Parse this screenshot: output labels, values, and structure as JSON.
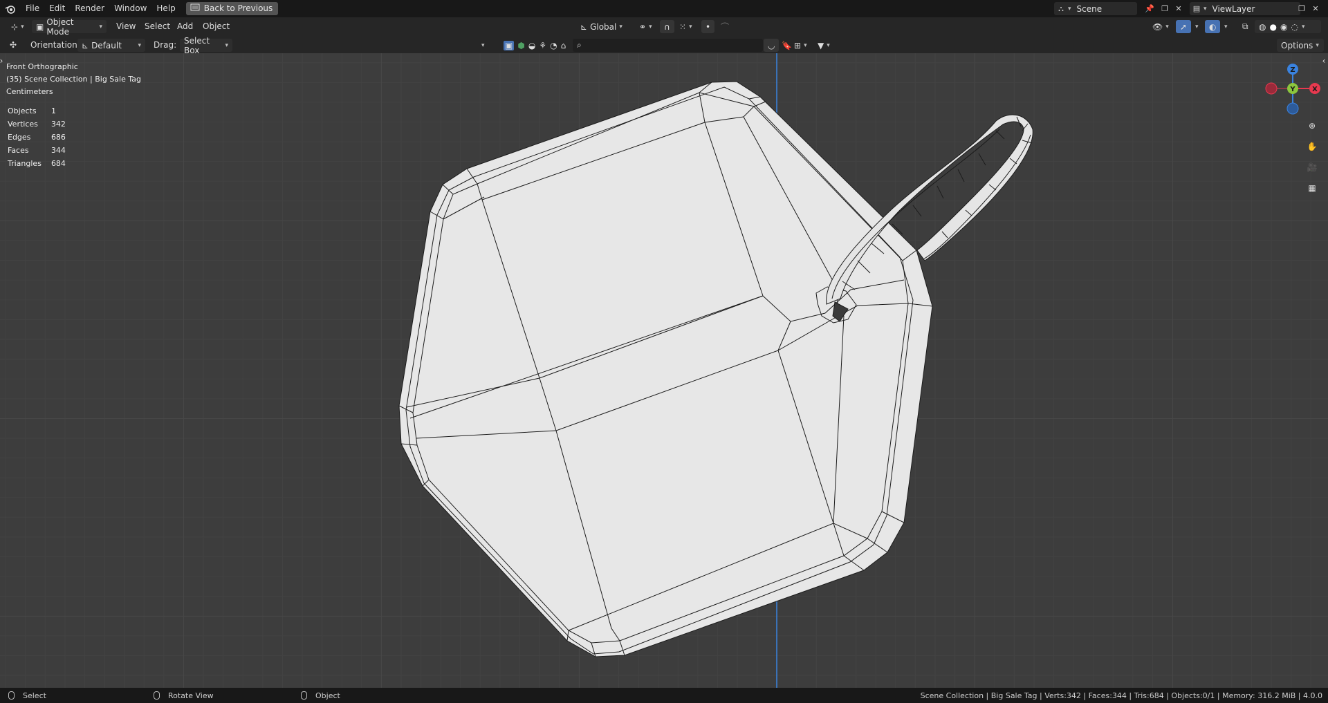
{
  "menu": {
    "file": "File",
    "edit": "Edit",
    "render": "Render",
    "window": "Window",
    "help": "Help",
    "back": "Back to Previous"
  },
  "scene": {
    "name": "Scene",
    "view_layer": "ViewLayer"
  },
  "header": {
    "mode": "Object Mode",
    "view": "View",
    "select": "Select",
    "add": "Add",
    "object": "Object",
    "transform_orientation": "Global"
  },
  "tool_settings": {
    "orientation_label": "Orientation:",
    "orientation_value": "Default",
    "drag_label": "Drag:",
    "drag_value": "Select Box",
    "options": "Options"
  },
  "viewport": {
    "view_name": "Front Orthographic",
    "collection": "(35) Scene Collection | Big Sale Tag",
    "units": "Centimeters",
    "stats": [
      {
        "label": "Objects",
        "value": "1"
      },
      {
        "label": "Vertices",
        "value": "342"
      },
      {
        "label": "Edges",
        "value": "686"
      },
      {
        "label": "Faces",
        "value": "344"
      },
      {
        "label": "Triangles",
        "value": "684"
      }
    ],
    "gizmo": {
      "z": "Z",
      "y": "Y",
      "x": "X"
    }
  },
  "statusbar": {
    "left_select": "Select",
    "rotate_view": "Rotate View",
    "object": "Object",
    "right": "Scene Collection | Big Sale Tag | Verts:342 | Faces:344 | Tris:684 | Objects:0/1 | Memory: 316.2 MiB | 4.0.0"
  },
  "colors": {
    "axis_x": "#e8394f",
    "axis_y": "#8cc63e",
    "axis_z": "#3a83e0",
    "accent": "#4772b3"
  }
}
